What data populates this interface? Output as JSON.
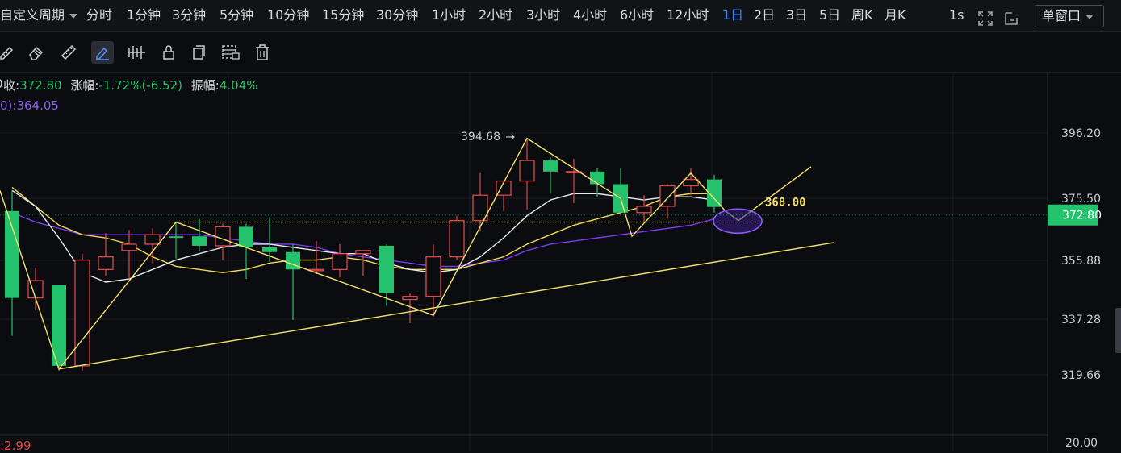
{
  "topbar": {
    "custom_period_label": "自定义周期",
    "timeframes": [
      "分时",
      "1分钟",
      "3分钟",
      "5分钟",
      "10分钟",
      "15分钟",
      "30分钟",
      "1小时",
      "2小时",
      "3小时",
      "4小时",
      "6小时",
      "12小时",
      "1日",
      "2日",
      "3日",
      "5日",
      "周K",
      "月K"
    ],
    "active_timeframe": "1日",
    "interval_label": "1s",
    "window_mode": "单窗口"
  },
  "toolbar": {
    "tools": [
      "ruler-pencil-icon",
      "eraser-icon",
      "ruler-icon",
      "pen-icon",
      "measure-icon",
      "lock-icon",
      "copy-icon",
      "grid-lock-icon",
      "trash-icon"
    ],
    "active_tool": "pen-icon"
  },
  "info": {
    "close_label": "收:",
    "close_value": "372.80",
    "change_label": "涨幅:",
    "change_value": "-1.72%(-6.52)",
    "amplitude_label": "振幅:",
    "amplitude_value": "4.04%",
    "ma_suffix": "0)",
    "ma_value": ":364.05",
    "bottom_value": ":2.99"
  },
  "colors": {
    "up": "#e0484c",
    "down": "#25c26e",
    "ma_white": "#e9ecef",
    "ma_yellow": "#f3d85a",
    "ma_purple": "#7c3aed",
    "drawing": "#f3e26a",
    "price_tag_bg": "#25c26e"
  },
  "chart_data": {
    "type": "candlestick",
    "y_axis_ticks": [
      396.2,
      375.5,
      355.88,
      337.28,
      319.66
    ],
    "volume_axis_tick": 20.0,
    "current_price": 372.8,
    "price_levels": [
      {
        "price": 368.0,
        "label": "368.00"
      }
    ],
    "high_marker": {
      "price": 394.68,
      "label": "394.68"
    },
    "candles": [
      {
        "o": 371.5,
        "h": 378.0,
        "l": 332.0,
        "c": 344.0
      },
      {
        "o": 344.0,
        "h": 353.5,
        "l": 340.0,
        "c": 349.5
      },
      {
        "o": 348.0,
        "h": 348.0,
        "l": 321.0,
        "c": 322.5
      },
      {
        "o": 322.5,
        "h": 358.0,
        "l": 321.0,
        "c": 356.0
      },
      {
        "o": 353.0,
        "h": 364.5,
        "l": 351.0,
        "c": 357.0
      },
      {
        "o": 359.0,
        "h": 365.5,
        "l": 350.0,
        "c": 361.0
      },
      {
        "o": 361.0,
        "h": 366.0,
        "l": 355.0,
        "c": 364.0
      },
      {
        "o": 363.5,
        "h": 368.0,
        "l": 356.5,
        "c": 363.0
      },
      {
        "o": 363.5,
        "h": 369.0,
        "l": 359.0,
        "c": 360.5
      },
      {
        "o": 360.5,
        "h": 367.5,
        "l": 356.0,
        "c": 366.5
      },
      {
        "o": 366.5,
        "h": 367.5,
        "l": 350.0,
        "c": 360.0
      },
      {
        "o": 360.0,
        "h": 369.5,
        "l": 355.5,
        "c": 358.5
      },
      {
        "o": 358.5,
        "h": 361.0,
        "l": 337.0,
        "c": 353.0
      },
      {
        "o": 353.0,
        "h": 362.0,
        "l": 351.5,
        "c": 353.0
      },
      {
        "o": 353.0,
        "h": 361.0,
        "l": 350.5,
        "c": 358.0
      },
      {
        "o": 358.0,
        "h": 359.0,
        "l": 351.0,
        "c": 359.0
      },
      {
        "o": 360.5,
        "h": 361.0,
        "l": 341.5,
        "c": 345.5
      },
      {
        "o": 343.5,
        "h": 345.5,
        "l": 336.0,
        "c": 344.5
      },
      {
        "o": 344.5,
        "h": 361.0,
        "l": 338.0,
        "c": 357.0
      },
      {
        "o": 357.0,
        "h": 370.0,
        "l": 356.0,
        "c": 368.5
      },
      {
        "o": 368.5,
        "h": 383.5,
        "l": 365.0,
        "c": 376.5
      },
      {
        "o": 376.5,
        "h": 380.0,
        "l": 371.5,
        "c": 381.0
      },
      {
        "o": 381.0,
        "h": 394.68,
        "l": 372.0,
        "c": 387.5
      },
      {
        "o": 387.5,
        "h": 388.5,
        "l": 377.0,
        "c": 384.0
      },
      {
        "o": 384.0,
        "h": 388.0,
        "l": 374.0,
        "c": 384.0
      },
      {
        "o": 384.0,
        "h": 385.0,
        "l": 376.0,
        "c": 380.0
      },
      {
        "o": 380.0,
        "h": 385.0,
        "l": 374.5,
        "c": 371.0
      },
      {
        "o": 371.0,
        "h": 376.5,
        "l": 368.0,
        "c": 373.0
      },
      {
        "o": 373.0,
        "h": 380.0,
        "l": 369.0,
        "c": 379.5
      },
      {
        "o": 379.5,
        "h": 385.0,
        "l": 376.5,
        "c": 381.5
      },
      {
        "o": 381.5,
        "h": 383.0,
        "l": 371.0,
        "c": 372.8
      }
    ],
    "ma_white": [
      378,
      373,
      363,
      352,
      349,
      350,
      353,
      356,
      358,
      360,
      361,
      361,
      360,
      359,
      358,
      358,
      355,
      353,
      352,
      353,
      357,
      363,
      370,
      375,
      377,
      377,
      376,
      375,
      376,
      376,
      375
    ],
    "ma_yellow": [
      379,
      373,
      367,
      364,
      363,
      361,
      357,
      354,
      353,
      352,
      353,
      355,
      356,
      356,
      357,
      356,
      354,
      353,
      353,
      353,
      355,
      357,
      361,
      364,
      367,
      369,
      371,
      373,
      376,
      377,
      377
    ],
    "ma_purple": [
      371,
      368,
      366,
      364,
      364,
      364,
      364,
      364,
      364,
      363,
      362,
      361,
      361,
      360,
      358,
      357,
      356,
      355,
      354,
      354,
      355,
      356,
      359,
      361,
      362,
      363,
      364,
      365,
      366,
      367,
      369
    ]
  }
}
